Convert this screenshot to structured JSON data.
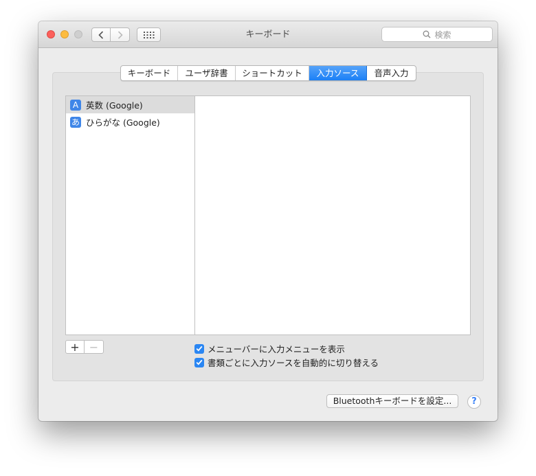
{
  "window": {
    "title": "キーボード"
  },
  "search": {
    "placeholder": "検索"
  },
  "tabs": [
    {
      "label": "キーボード",
      "active": false
    },
    {
      "label": "ユーザ辞書",
      "active": false
    },
    {
      "label": "ショートカット",
      "active": false
    },
    {
      "label": "入力ソース",
      "active": true
    },
    {
      "label": "音声入力",
      "active": false
    }
  ],
  "input_sources": [
    {
      "badge": "A",
      "label": "英数 (Google)",
      "selected": true
    },
    {
      "badge": "あ",
      "label": "ひらがな (Google)",
      "selected": false
    }
  ],
  "buttons": {
    "add": "+",
    "remove": "−"
  },
  "options": [
    {
      "label": "メニューバーに入力メニューを表示",
      "checked": true
    },
    {
      "label": "書類ごとに入力ソースを自動的に切り替える",
      "checked": true
    }
  ],
  "footer": {
    "bluetooth_label": "Bluetoothキーボードを設定...",
    "help_label": "?"
  },
  "colors": {
    "accent": "#1b80f6",
    "close": "#fc605c",
    "minimize": "#fdbc40"
  },
  "icons": [
    "back-chevron-icon",
    "forward-chevron-icon",
    "grid-icon",
    "search-icon",
    "checkmark-icon"
  ]
}
